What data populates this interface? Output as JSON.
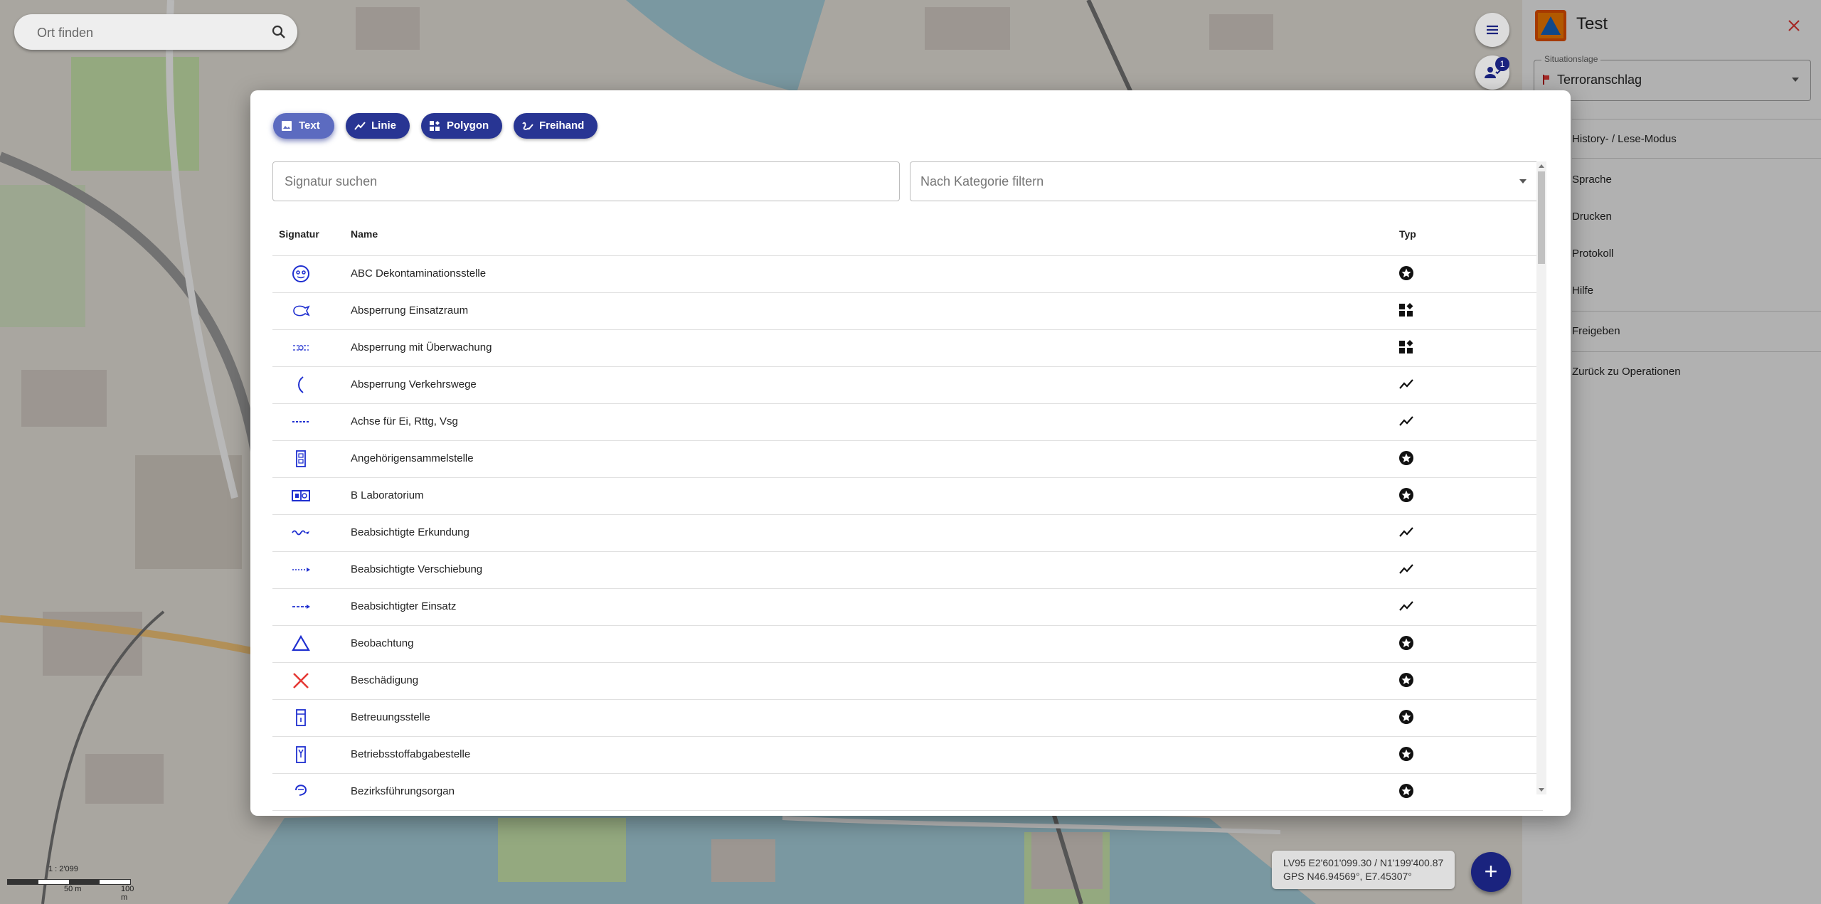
{
  "map": {
    "search_placeholder": "Ort finden",
    "users_badge": "1",
    "coords_line1": "LV95 E2'601'099.30 / N1'199'400.87",
    "coords_line2": "GPS N46.94569°, E7.45307°",
    "scale_ratio": "1 : 2'099",
    "scale_tick1": "50 m",
    "scale_tick2": "100 m",
    "add_button": "+"
  },
  "panel": {
    "title": "Test",
    "situation_label": "Situationslage",
    "situation_value": "Terroranschlag",
    "menu": [
      "History- / Lese-Modus",
      "Sprache",
      "Drucken",
      "Protokoll",
      "Hilfe",
      "Freigeben",
      "Zurück zu Operationen"
    ]
  },
  "modal": {
    "tabs": [
      "Text",
      "Linie",
      "Polygon",
      "Freihand"
    ],
    "search_placeholder": "Signatur suchen",
    "category_placeholder": "Nach Kategorie filtern",
    "columns": [
      "Signatur",
      "Name",
      "Typ"
    ],
    "rows": [
      {
        "name": "ABC Dekontaminationsstelle",
        "type": "point",
        "icon": "decontamination-icon"
      },
      {
        "name": "Absperrung Einsatzraum",
        "type": "polygon",
        "icon": "cordon-area-icon"
      },
      {
        "name": "Absperrung mit Überwachung",
        "type": "polygon",
        "icon": "cordon-surveillance-icon"
      },
      {
        "name": "Absperrung Verkehrswege",
        "type": "line",
        "icon": "road-block-icon"
      },
      {
        "name": "Achse für Ei, Rttg, Vsg",
        "type": "line",
        "icon": "axis-icon"
      },
      {
        "name": "Angehörigensammelstelle",
        "type": "point",
        "icon": "relatives-point-icon"
      },
      {
        "name": "B Laboratorium",
        "type": "point",
        "icon": "laboratory-icon"
      },
      {
        "name": "Beabsichtigte Erkundung",
        "type": "line",
        "icon": "reconnaissance-icon"
      },
      {
        "name": "Beabsichtigte Verschiebung",
        "type": "line",
        "icon": "relocation-icon"
      },
      {
        "name": "Beabsichtigter Einsatz",
        "type": "line",
        "icon": "deployment-icon"
      },
      {
        "name": "Beobachtung",
        "type": "point",
        "icon": "observation-triangle-icon"
      },
      {
        "name": "Beschädigung",
        "type": "point",
        "icon": "damage-cross-icon"
      },
      {
        "name": "Betreuungsstelle",
        "type": "point",
        "icon": "care-point-icon"
      },
      {
        "name": "Betriebsstoffabgabestelle",
        "type": "point",
        "icon": "fuel-point-icon"
      },
      {
        "name": "Bezirksführungsorgan",
        "type": "point",
        "icon": "district-command-icon"
      }
    ]
  },
  "colors": {
    "accent": "#283593",
    "accent_light": "#5c6bc0",
    "symbol_blue": "#1f2fd0",
    "symbol_red": "#e53935",
    "logo_orange": "#e65100"
  }
}
